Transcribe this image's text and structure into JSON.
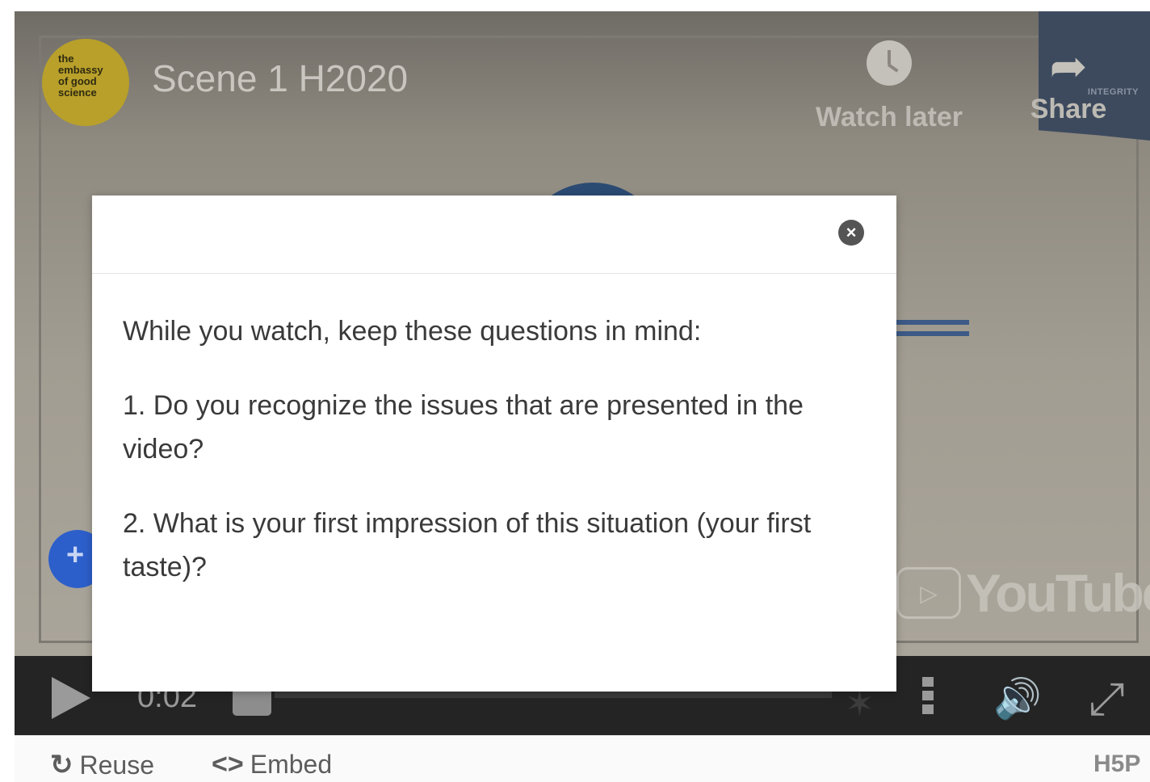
{
  "video": {
    "logo_lines": [
      "the",
      "embassy",
      "of good",
      "science"
    ],
    "title": "Scene 1 H2020",
    "watch_later_label": "Watch later",
    "share_label": "Share",
    "share_badge": "INTEGRITY",
    "youtube_label": "YouTube"
  },
  "controls": {
    "time": "0:02",
    "icons": [
      "play-icon",
      "bookmark-icon",
      "more-icon",
      "volume-icon",
      "fullscreen-icon"
    ]
  },
  "dialog": {
    "intro": "While you watch, keep these questions in mind:",
    "questions": [
      "1. Do you recognize the issues that are presented in the video?",
      "2. What is your first impression of this situation (your first taste)?"
    ],
    "close_icon": "close-icon"
  },
  "footer": {
    "reuse_label": "Reuse",
    "embed_label": "Embed",
    "brand": "H5P"
  },
  "colors": {
    "plus_button": "#2d5fcb",
    "control_bar": "#242424",
    "logo": "#b8a02a"
  }
}
